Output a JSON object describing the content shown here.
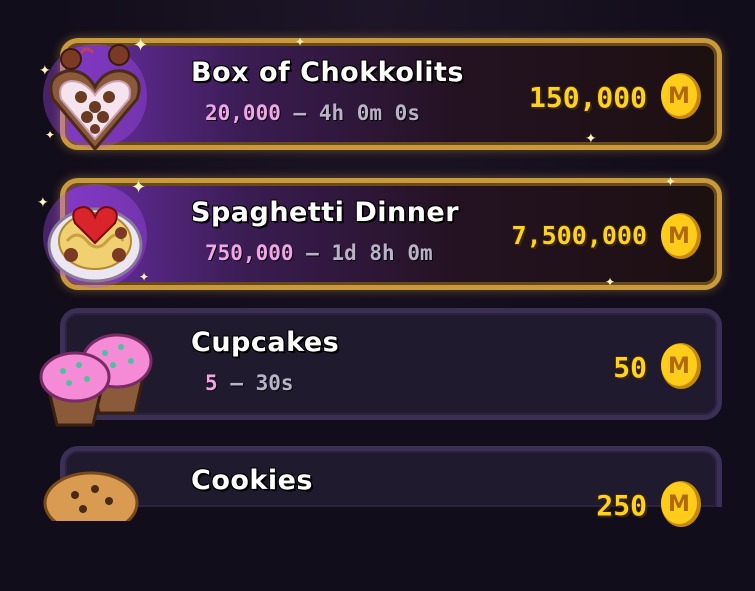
{
  "items": [
    {
      "title": "Box of Chokkolits",
      "quantity": "20,000",
      "separator": "–",
      "duration": "4h 0m 0s",
      "price": "150,000",
      "style": "premium",
      "icon": "chocolate-box-icon"
    },
    {
      "title": "Spaghetti Dinner",
      "quantity": "750,000",
      "separator": "–",
      "duration": "1d 8h 0m",
      "price": "7,500,000",
      "style": "premium",
      "icon": "spaghetti-icon"
    },
    {
      "title": "Cupcakes",
      "quantity": "5",
      "separator": "–",
      "duration": "30s",
      "price": "50",
      "style": "regular",
      "icon": "cupcake-icon"
    },
    {
      "title": "Cookies",
      "price": "250",
      "style": "regular",
      "icon": "cookie-icon"
    }
  ],
  "colors": {
    "gold": "#ffd21f",
    "quantity": "#f2a6e8",
    "premium_border": "#c99a3c",
    "regular_border": "#3b2f55"
  }
}
